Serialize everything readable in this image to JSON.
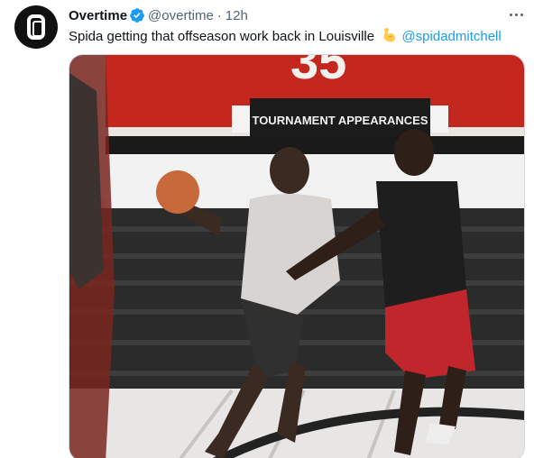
{
  "tweet": {
    "name": "Overtime",
    "handle": "@overtime",
    "separator": "·",
    "time": "12h",
    "text": "Spida getting that offseason work back in Louisville",
    "mention": "@spidadmitchell"
  },
  "media": {
    "banner_text": "TOURNAMENT APPEARANCES",
    "scoreboard_number": "35"
  },
  "colors": {
    "accent": "#1d9bf0",
    "verified": "#1d9bf0",
    "text": "#0f1419",
    "secondary": "#536471"
  },
  "icons": {
    "verified": "verified-badge-icon",
    "more": "more-horizontal-icon",
    "emoji": "flexed-biceps-emoji"
  }
}
